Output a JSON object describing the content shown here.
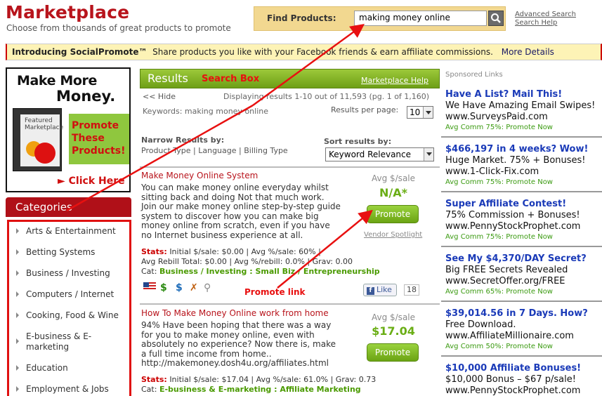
{
  "header": {
    "title": "Marketplace",
    "tagline": "Choose from thousands of great products to promote",
    "find_label": "Find Products:",
    "search_value": "making money online",
    "advanced_search": "Advanced Search",
    "search_help": "Search Help"
  },
  "intro": {
    "bold": "Introducing SocialPromote™",
    "text": "Share products you like with your Facebook friends & earn affiliate commissions.",
    "link": "More Details"
  },
  "promo": {
    "line1": "Make More",
    "line2": "Money.",
    "box_text": "Featured Marketplace",
    "body": [
      "Promote",
      "These",
      "Products!"
    ],
    "click": "Click Here"
  },
  "categories": {
    "header": "Categories",
    "items": [
      "Arts & Entertainment",
      "Betting Systems",
      "Business / Investing",
      "Computers / Internet",
      "Cooking, Food & Wine",
      "E-business & E-marketing",
      "Education",
      "Employment & Jobs"
    ]
  },
  "results": {
    "title": "Results",
    "annotation": "Search Box",
    "help": "Marketplace Help",
    "hide": "<< Hide",
    "displaying": "Displaying results 1-10 out of 11,593 (pg. 1 of 1,160)",
    "keywords": "Keywords: making money online",
    "per_page_label": "Results per page:",
    "per_page_value": "10",
    "narrow_label": "Narrow Results by:",
    "narrow_links": "Product Type | Language | Billing Type",
    "sort_label": "Sort results by:",
    "sort_value": "Keyword Relevance"
  },
  "listings": [
    {
      "title": "Make Money Online System",
      "desc": "You can make money online everyday whilst sitting back and doing Not that much work. Join our make money online step-by-step guide system to discover how you can make big money online from scratch, even if you have no Internet business experience at all.",
      "avg_label": "Avg $/sale",
      "avg_value": "N/A*",
      "promote": "Promote",
      "vendor": "Vendor Spotlight",
      "stats_label": "Stats:",
      "stats_line1": "Initial $/sale: $0.00 | Avg %/sale: 60% |",
      "stats_line2": "Avg Rebill Total: $0.00 | Avg %/rebill: 0.0% | Grav: 0.00",
      "cat_label": "Cat:",
      "cat_value": "Business / Investing : Small Biz / Entrepreneurship",
      "like": "Like",
      "like_count": "18",
      "annotation": "Promote link"
    },
    {
      "title": "How To Make Money Online work from home",
      "desc": "94% Have been hoping that there was a way for you to make money online, even with absolutely no experience? Now there is, make a full time income from home.. http://makemoney.dosh4u.org/affiliates.html",
      "avg_label": "Avg $/sale",
      "avg_value": "$17.04",
      "promote": "Promote",
      "stats_label": "Stats:",
      "stats_line1": "Initial $/sale: $17.04 | Avg %/sale: 61.0% | Grav: 0.73",
      "cat_label": "Cat:",
      "cat_value": "E-business & E-marketing : Affiliate Marketing"
    }
  ],
  "sponsored": {
    "label": "Sponsored Links",
    "ads": [
      {
        "title": "Have A List? Mail This!",
        "line": "We Have Amazing Email Swipes!",
        "url": "www.SurveysPaid.com",
        "comm": "Avg Comm 75%: Promote Now"
      },
      {
        "title": "$466,197 in 4 weeks? Wow!",
        "line": "Huge Market. 75% + Bonuses!",
        "url": "www.1-Click-Fix.com",
        "comm": "Avg Comm 75%: Promote Now"
      },
      {
        "title": "Super Affiliate Contest!",
        "line": "75% Commission + Bonuses!",
        "url": "www.PennyStockProphet.com",
        "comm": "Avg Comm 75%: Promote Now"
      },
      {
        "title": "See My $4,370/DAY Secret?",
        "line": "Big FREE Secrets Revealed",
        "url": "www.SecretOffer.org/FREE",
        "comm": "Avg Comm 65%: Promote Now"
      },
      {
        "title": "$39,014.56 in 7 Days. How?",
        "line": "Free Download.",
        "url": "www.AffiliateMillionaire.com",
        "comm": "Avg Comm 50%: Promote Now"
      },
      {
        "title": "$10,000 Affiliate Bonuses!",
        "line": "$10,000 Bonus – $67 p/sale!",
        "url": "www.PennyStockProphet.com",
        "comm": ""
      }
    ]
  },
  "colors": {
    "brand_red": "#b8141c",
    "accent_green": "#6aae15",
    "ad_blue": "#1a3ab8",
    "annotation_red": "#e81010"
  }
}
